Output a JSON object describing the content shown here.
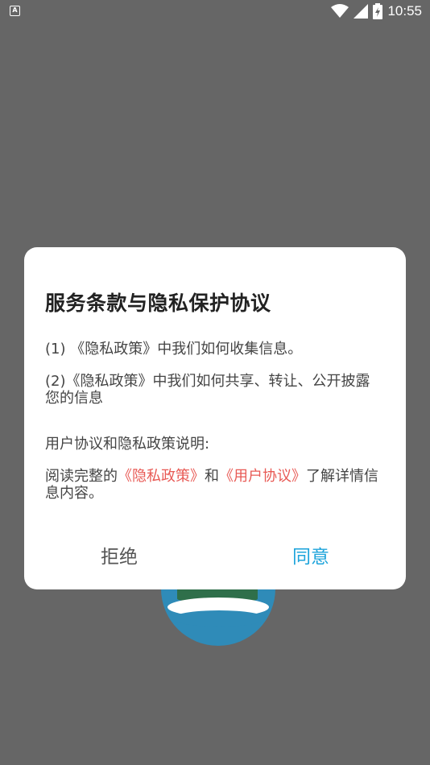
{
  "status_bar": {
    "notification_icon": "A",
    "time": "10:55",
    "icons": [
      "wifi-icon",
      "signal-icon",
      "battery-icon"
    ]
  },
  "dialog": {
    "title": "服务条款与隐私保护协议",
    "item1": "(1) 《隐私政策》中我们如何收集信息。",
    "item2": "(2)《隐私政策》中我们如何共享、转让、公开披露您的信息",
    "section_label": "用户协议和隐私政策说明:",
    "read_prefix": "阅读完整的",
    "privacy_link": "《隐私政策》",
    "and_text": "和",
    "user_agreement_link": "《用户协议》",
    "read_suffix": "了解详情信息内容。",
    "reject_label": "拒绝",
    "agree_label": "同意"
  },
  "colors": {
    "overlay": "#666666",
    "link": "#e85a55",
    "agree": "#1ea4db"
  }
}
